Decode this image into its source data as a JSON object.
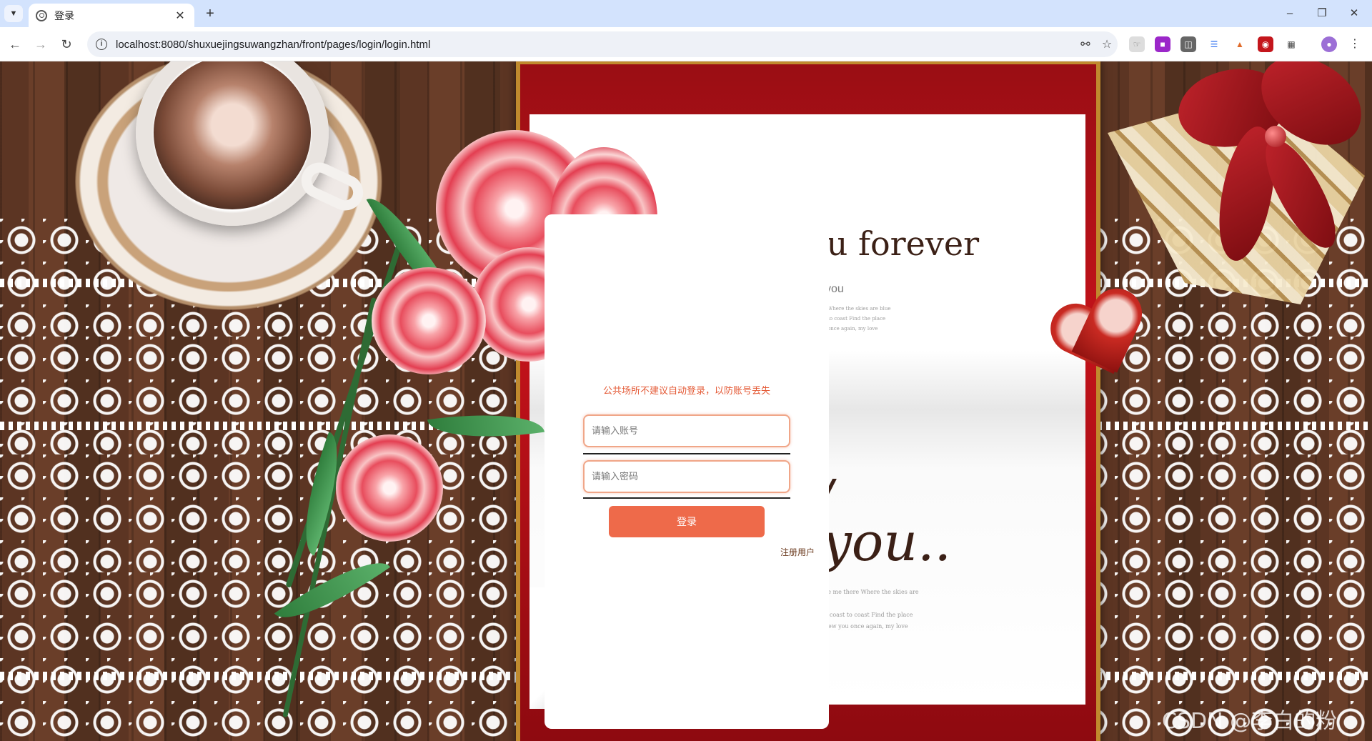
{
  "browser": {
    "tab_title": "登录",
    "url": "localhost:8080/shuxuejingsuwangzhan/front/pages/login/login.html"
  },
  "scene": {
    "headline": "I love you forever",
    "sub_text": "you",
    "script_text": "you..",
    "script_fragment": "/",
    "poem_lines": [
      "So I say a little prayer Hope my dreams will take me there Where the skies are blue",
      "to see you once again my love Over seas from coast to coast Find the place",
      "I loved the most Where the fields are greenfew you once again, my love"
    ],
    "tiny_lines": [
      "Where the skies are blue",
      "to coast Find the place",
      "once again, my love"
    ]
  },
  "login": {
    "notice": "公共场所不建议自动登录，以防账号丢失",
    "account_placeholder": "请输入账号",
    "password_placeholder": "请输入密码",
    "login_button": "登录",
    "register_link": "注册用户"
  },
  "watermark": "CSDN @李白的粉"
}
